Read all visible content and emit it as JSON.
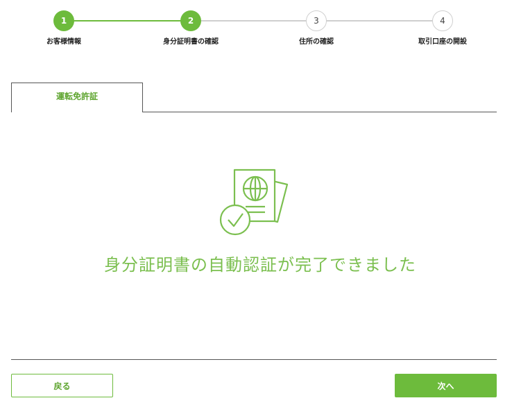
{
  "stepper": {
    "steps": [
      {
        "number": "1",
        "label": "お客様情報",
        "state": "done"
      },
      {
        "number": "2",
        "label": "身分証明書の確認",
        "state": "current"
      },
      {
        "number": "3",
        "label": "住所の確認",
        "state": "todo"
      },
      {
        "number": "4",
        "label": "取引口座の開設",
        "state": "todo"
      }
    ]
  },
  "tabs": [
    {
      "label": "運転免許証",
      "active": true
    }
  ],
  "main": {
    "icon": "passport-check-icon",
    "message": "身分証明書の自動認証が完了できました"
  },
  "footer": {
    "back_label": "戻る",
    "next_label": "次へ"
  },
  "colors": {
    "accent": "#6dbb3c",
    "inactive": "#cfcfcf",
    "text": "#222222"
  }
}
